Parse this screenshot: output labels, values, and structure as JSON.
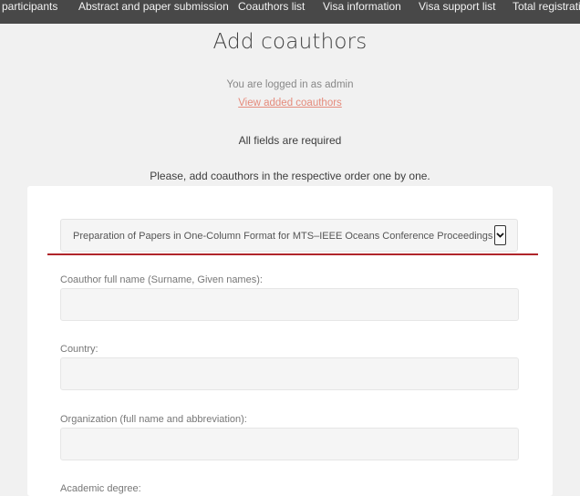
{
  "nav": {
    "items": [
      {
        "label": "participants"
      },
      {
        "label": "Abstract and paper submission"
      },
      {
        "label": "Coauthors list"
      },
      {
        "label": "Visa information"
      },
      {
        "label": "Visa support list"
      },
      {
        "label": "Total registratio"
      }
    ]
  },
  "header": {
    "title": "Add coauthors",
    "logged_in": "You are logged in as admin",
    "view_link": "View added coauthors",
    "required_note": "All fields are required",
    "instruction": "Please, add coauthors in the respective order one by one."
  },
  "form": {
    "paper_select": {
      "selected": "Preparation of Papers in One-Column Format for MTS–IEEE Oceans Conference Proceedings",
      "icon": "chevron-down-icon"
    },
    "fields": [
      {
        "label": "Coauthor full name (Surname, Given names):",
        "value": ""
      },
      {
        "label": "Country:",
        "value": ""
      },
      {
        "label": "Organization (full name and abbreviation):",
        "value": ""
      },
      {
        "label": "Academic degree:",
        "value": ""
      }
    ]
  },
  "colors": {
    "nav_bg": "#484848",
    "page_bg": "#f1f1f1",
    "link": "#e58b7c",
    "accent_line": "#b0252a"
  }
}
